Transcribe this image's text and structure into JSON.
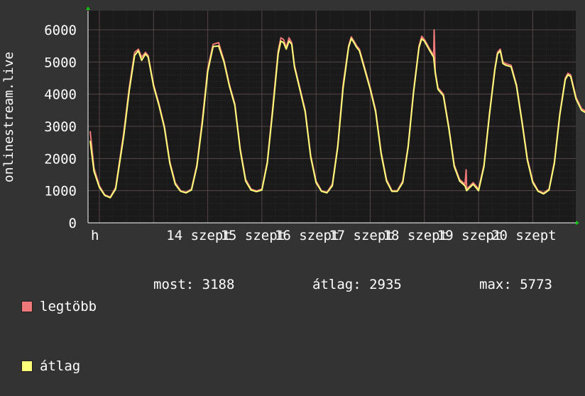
{
  "colors": {
    "background": "#333333",
    "plot_bg": "#1a1a1a",
    "grid": "#5a4a4a",
    "axis": "#ffffff",
    "max_line": "#f07878",
    "avg_line": "#ffff7a",
    "arrow": "#11cc11"
  },
  "chart_data": {
    "type": "line",
    "ylabel": "onlinestream.live",
    "ylim": [
      0,
      6000
    ],
    "yticks": [
      "0",
      "1000",
      "2000",
      "3000",
      "4000",
      "5000",
      "6000"
    ],
    "xticks": [
      "h",
      "14 szept",
      "15 szept",
      "16 szept",
      "17 szept",
      "18 szept",
      "19 szept",
      "20 szept"
    ],
    "grid": true,
    "x_unit": "day index (0 = start, each integer = new day at tick)",
    "series": [
      {
        "name": "legtöbb",
        "color": "#f07878",
        "points": [
          [
            -0.17,
            2850
          ],
          [
            -0.1,
            1700
          ],
          [
            0.0,
            1150
          ],
          [
            0.1,
            870
          ],
          [
            0.2,
            800
          ],
          [
            0.3,
            1100
          ],
          [
            0.45,
            2800
          ],
          [
            0.55,
            4200
          ],
          [
            0.65,
            5300
          ],
          [
            0.72,
            5400
          ],
          [
            0.78,
            5150
          ],
          [
            0.85,
            5300
          ],
          [
            0.9,
            5200
          ],
          [
            1.0,
            4300
          ],
          [
            1.1,
            3700
          ],
          [
            1.2,
            3000
          ],
          [
            1.3,
            1900
          ],
          [
            1.4,
            1250
          ],
          [
            1.5,
            1000
          ],
          [
            1.6,
            950
          ],
          [
            1.7,
            1050
          ],
          [
            1.8,
            1800
          ],
          [
            1.9,
            3200
          ],
          [
            2.0,
            4800
          ],
          [
            2.1,
            5550
          ],
          [
            2.2,
            5600
          ],
          [
            2.3,
            5050
          ],
          [
            2.4,
            4300
          ],
          [
            2.5,
            3700
          ],
          [
            2.6,
            2300
          ],
          [
            2.7,
            1350
          ],
          [
            2.8,
            1050
          ],
          [
            2.9,
            990
          ],
          [
            3.0,
            1050
          ],
          [
            3.1,
            1900
          ],
          [
            3.2,
            3600
          ],
          [
            3.3,
            5350
          ],
          [
            3.35,
            5750
          ],
          [
            3.4,
            5700
          ],
          [
            3.45,
            5450
          ],
          [
            3.5,
            5750
          ],
          [
            3.55,
            5600
          ],
          [
            3.6,
            4900
          ],
          [
            3.7,
            4200
          ],
          [
            3.8,
            3500
          ],
          [
            3.9,
            2100
          ],
          [
            4.0,
            1300
          ],
          [
            4.1,
            1000
          ],
          [
            4.2,
            950
          ],
          [
            4.3,
            1200
          ],
          [
            4.4,
            2400
          ],
          [
            4.5,
            4300
          ],
          [
            4.6,
            5500
          ],
          [
            4.65,
            5780
          ],
          [
            4.7,
            5650
          ],
          [
            4.75,
            5500
          ],
          [
            4.8,
            5400
          ],
          [
            4.9,
            4800
          ],
          [
            5.0,
            4200
          ],
          [
            5.1,
            3500
          ],
          [
            5.2,
            2200
          ],
          [
            5.3,
            1350
          ],
          [
            5.4,
            1000
          ],
          [
            5.5,
            1000
          ],
          [
            5.6,
            1300
          ],
          [
            5.7,
            2400
          ],
          [
            5.8,
            4100
          ],
          [
            5.9,
            5500
          ],
          [
            5.95,
            5800
          ],
          [
            6.0,
            5700
          ],
          [
            6.1,
            5400
          ],
          [
            6.17,
            5200
          ],
          [
            6.18,
            6000
          ],
          [
            6.2,
            4700
          ],
          [
            6.25,
            4200
          ],
          [
            6.35,
            4000
          ],
          [
            6.45,
            3000
          ],
          [
            6.55,
            1800
          ],
          [
            6.65,
            1350
          ],
          [
            6.75,
            1200
          ],
          [
            6.77,
            1650
          ],
          [
            6.78,
            1050
          ],
          [
            6.9,
            1250
          ],
          [
            7.0,
            1050
          ],
          [
            7.1,
            1800
          ],
          [
            7.2,
            3400
          ],
          [
            7.3,
            4800
          ],
          [
            7.35,
            5300
          ],
          [
            7.4,
            5400
          ],
          [
            7.45,
            5000
          ],
          [
            7.5,
            4950
          ],
          [
            7.6,
            4900
          ],
          [
            7.7,
            4300
          ],
          [
            7.8,
            3200
          ],
          [
            7.9,
            2000
          ],
          [
            8.0,
            1300
          ],
          [
            8.1,
            1000
          ],
          [
            8.2,
            930
          ],
          [
            8.3,
            1050
          ],
          [
            8.4,
            1900
          ],
          [
            8.5,
            3400
          ],
          [
            8.6,
            4500
          ],
          [
            8.65,
            4650
          ],
          [
            8.7,
            4600
          ],
          [
            8.8,
            3900
          ],
          [
            8.9,
            3550
          ],
          [
            9.0,
            3450
          ],
          [
            9.05,
            3350
          ],
          [
            9.1,
            3200
          ]
        ]
      },
      {
        "name": "átlag",
        "color": "#ffff7a",
        "points": [
          [
            -0.17,
            2550
          ],
          [
            -0.1,
            1600
          ],
          [
            0.0,
            1100
          ],
          [
            0.1,
            850
          ],
          [
            0.2,
            780
          ],
          [
            0.3,
            1050
          ],
          [
            0.45,
            2700
          ],
          [
            0.55,
            4100
          ],
          [
            0.65,
            5200
          ],
          [
            0.72,
            5350
          ],
          [
            0.78,
            5050
          ],
          [
            0.85,
            5250
          ],
          [
            0.9,
            5150
          ],
          [
            1.0,
            4250
          ],
          [
            1.1,
            3650
          ],
          [
            1.2,
            2950
          ],
          [
            1.3,
            1850
          ],
          [
            1.4,
            1200
          ],
          [
            1.5,
            980
          ],
          [
            1.6,
            930
          ],
          [
            1.7,
            1020
          ],
          [
            1.8,
            1750
          ],
          [
            1.9,
            3100
          ],
          [
            2.0,
            4700
          ],
          [
            2.1,
            5480
          ],
          [
            2.2,
            5500
          ],
          [
            2.3,
            5000
          ],
          [
            2.4,
            4250
          ],
          [
            2.5,
            3650
          ],
          [
            2.6,
            2250
          ],
          [
            2.7,
            1300
          ],
          [
            2.8,
            1020
          ],
          [
            2.9,
            970
          ],
          [
            3.0,
            1020
          ],
          [
            3.1,
            1850
          ],
          [
            3.2,
            3500
          ],
          [
            3.3,
            5250
          ],
          [
            3.35,
            5650
          ],
          [
            3.4,
            5600
          ],
          [
            3.45,
            5400
          ],
          [
            3.5,
            5650
          ],
          [
            3.55,
            5550
          ],
          [
            3.6,
            4850
          ],
          [
            3.7,
            4150
          ],
          [
            3.8,
            3450
          ],
          [
            3.9,
            2050
          ],
          [
            4.0,
            1250
          ],
          [
            4.1,
            980
          ],
          [
            4.2,
            930
          ],
          [
            4.3,
            1150
          ],
          [
            4.4,
            2350
          ],
          [
            4.5,
            4200
          ],
          [
            4.6,
            5450
          ],
          [
            4.65,
            5730
          ],
          [
            4.7,
            5600
          ],
          [
            4.75,
            5450
          ],
          [
            4.8,
            5350
          ],
          [
            4.9,
            4750
          ],
          [
            5.0,
            4150
          ],
          [
            5.1,
            3450
          ],
          [
            5.2,
            2150
          ],
          [
            5.3,
            1300
          ],
          [
            5.4,
            980
          ],
          [
            5.5,
            980
          ],
          [
            5.6,
            1250
          ],
          [
            5.7,
            2350
          ],
          [
            5.8,
            4050
          ],
          [
            5.9,
            5450
          ],
          [
            5.95,
            5720
          ],
          [
            6.0,
            5650
          ],
          [
            6.1,
            5350
          ],
          [
            6.17,
            5150
          ],
          [
            6.2,
            4650
          ],
          [
            6.25,
            4150
          ],
          [
            6.35,
            3950
          ],
          [
            6.45,
            2950
          ],
          [
            6.55,
            1750
          ],
          [
            6.65,
            1300
          ],
          [
            6.75,
            1150
          ],
          [
            6.78,
            1000
          ],
          [
            6.9,
            1200
          ],
          [
            7.0,
            1000
          ],
          [
            7.1,
            1750
          ],
          [
            7.2,
            3350
          ],
          [
            7.3,
            4750
          ],
          [
            7.35,
            5250
          ],
          [
            7.4,
            5350
          ],
          [
            7.45,
            4950
          ],
          [
            7.5,
            4900
          ],
          [
            7.6,
            4850
          ],
          [
            7.7,
            4250
          ],
          [
            7.8,
            3150
          ],
          [
            7.9,
            1950
          ],
          [
            8.0,
            1250
          ],
          [
            8.1,
            980
          ],
          [
            8.2,
            900
          ],
          [
            8.3,
            1020
          ],
          [
            8.4,
            1850
          ],
          [
            8.5,
            3350
          ],
          [
            8.6,
            4450
          ],
          [
            8.65,
            4600
          ],
          [
            8.7,
            4550
          ],
          [
            8.8,
            3850
          ],
          [
            8.9,
            3500
          ],
          [
            9.0,
            3400
          ],
          [
            9.05,
            3300
          ],
          [
            9.1,
            3150
          ]
        ]
      }
    ]
  },
  "legend": {
    "max_label": "legtöbb",
    "avg_label": "átlag",
    "now": "most: 3188",
    "avg": "átlag: 2935",
    "max": "max: 5773"
  }
}
